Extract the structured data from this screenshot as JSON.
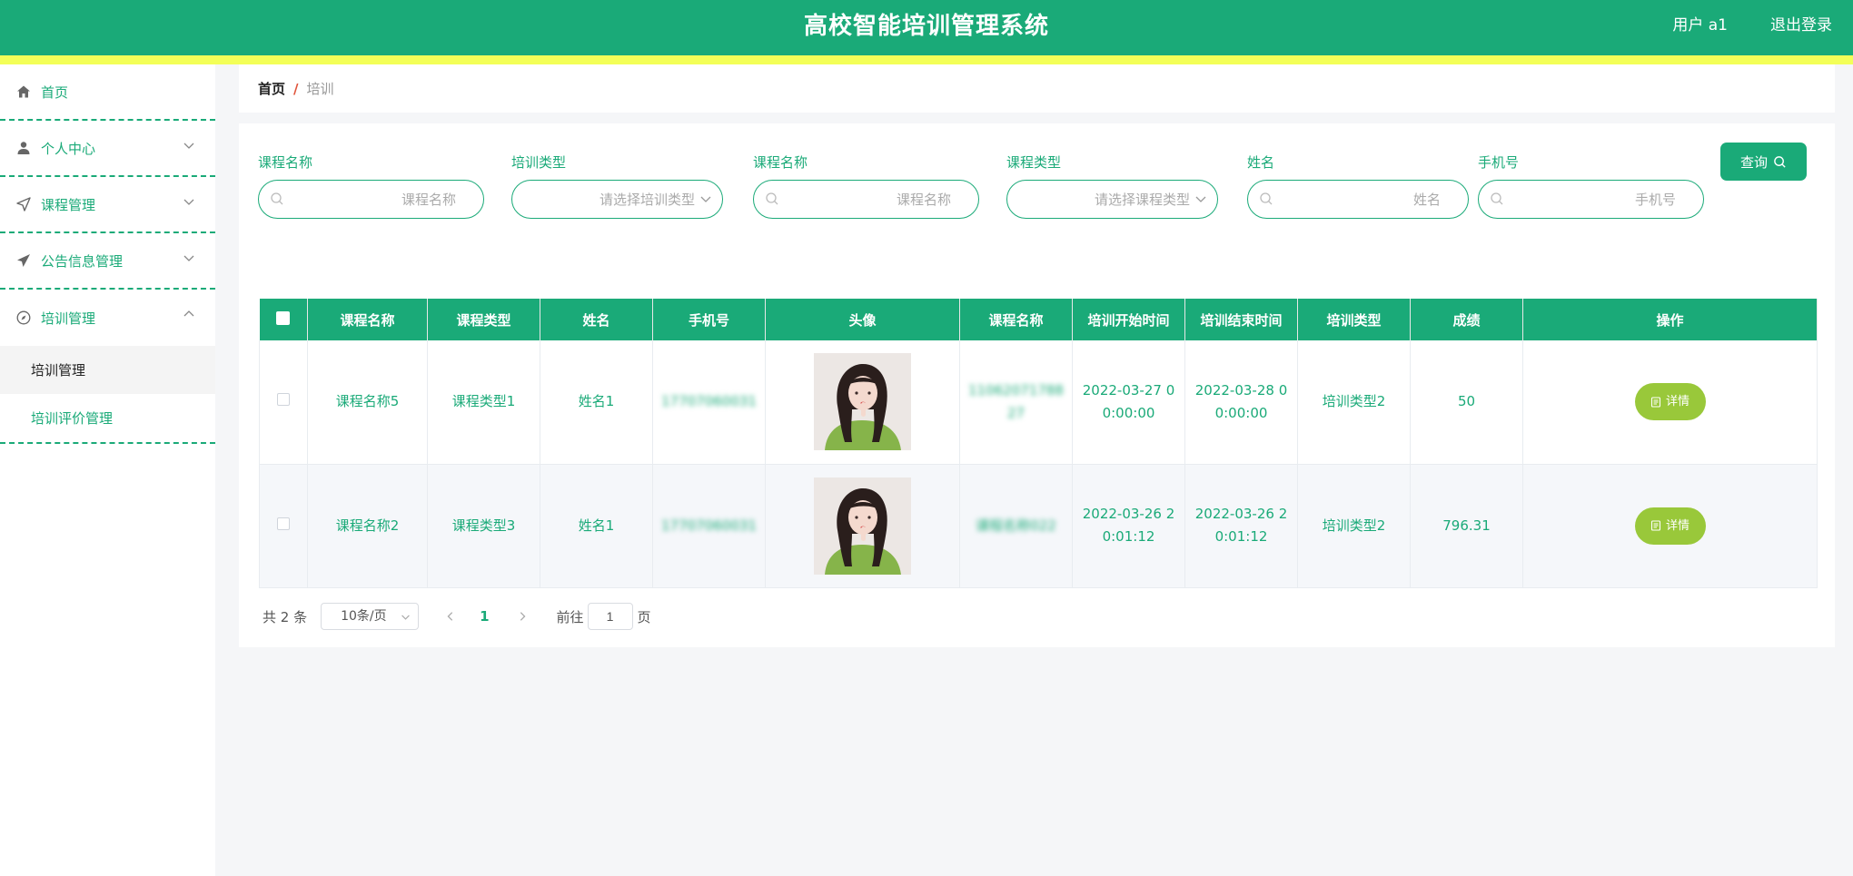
{
  "header": {
    "title": "高校智能培训管理系统",
    "user": "用户 a1",
    "logout": "退出登录"
  },
  "sidebar": {
    "items": [
      {
        "label": "首页",
        "icon": "home-icon"
      },
      {
        "label": "个人中心",
        "icon": "user-icon"
      },
      {
        "label": "课程管理",
        "icon": "send-icon"
      },
      {
        "label": "公告信息管理",
        "icon": "paper-plane-icon"
      },
      {
        "label": "培训管理",
        "icon": "compass-icon",
        "expanded": true,
        "children": [
          {
            "label": "培训管理",
            "active": true
          },
          {
            "label": "培训评价管理"
          }
        ]
      }
    ]
  },
  "breadcrumb": {
    "home": "首页",
    "separator": "/",
    "current": "培训"
  },
  "filters": [
    {
      "label": "课程名称",
      "placeholder": "课程名称",
      "type": "text"
    },
    {
      "label": "培训类型",
      "placeholder": "请选择培训类型",
      "type": "select"
    },
    {
      "label": "课程名称",
      "placeholder": "课程名称",
      "type": "text"
    },
    {
      "label": "课程类型",
      "placeholder": "请选择课程类型",
      "type": "select"
    },
    {
      "label": "姓名",
      "placeholder": "姓名",
      "type": "text"
    },
    {
      "label": "手机号",
      "placeholder": "手机号",
      "type": "text"
    }
  ],
  "query_button": "查询",
  "table": {
    "columns": [
      "课程名称",
      "课程类型",
      "姓名",
      "手机号",
      "头像",
      "课程名称",
      "培训开始时间",
      "培训结束时间",
      "培训类型",
      "成绩",
      "操作"
    ],
    "rows": [
      {
        "course": "课程名称5",
        "course_type": "课程类型1",
        "name": "姓名1",
        "phone": "17707060031",
        "course2": "11062071788 27",
        "start": "2022-03-27 0 0:00:00",
        "end": "2022-03-28 0 0:00:00",
        "train_type": "培训类型2",
        "score": "50",
        "action": "详情"
      },
      {
        "course": "课程名称2",
        "course_type": "课程类型3",
        "name": "姓名1",
        "phone": "17707060031",
        "course2": "课程名称022",
        "start": "2022-03-26 2 0:01:12",
        "end": "2022-03-26 2 0:01:12",
        "train_type": "培训类型2",
        "score": "796.31",
        "action": "详情"
      }
    ]
  },
  "pagination": {
    "total": "共 2 条",
    "page_size": "10条/页",
    "current_page": "1",
    "goto_label": "前往",
    "goto_value": "1",
    "goto_suffix": "页"
  },
  "colors": {
    "primary": "#1aaa78",
    "stripe": "#f3ff58",
    "detail": "#99c83a"
  }
}
